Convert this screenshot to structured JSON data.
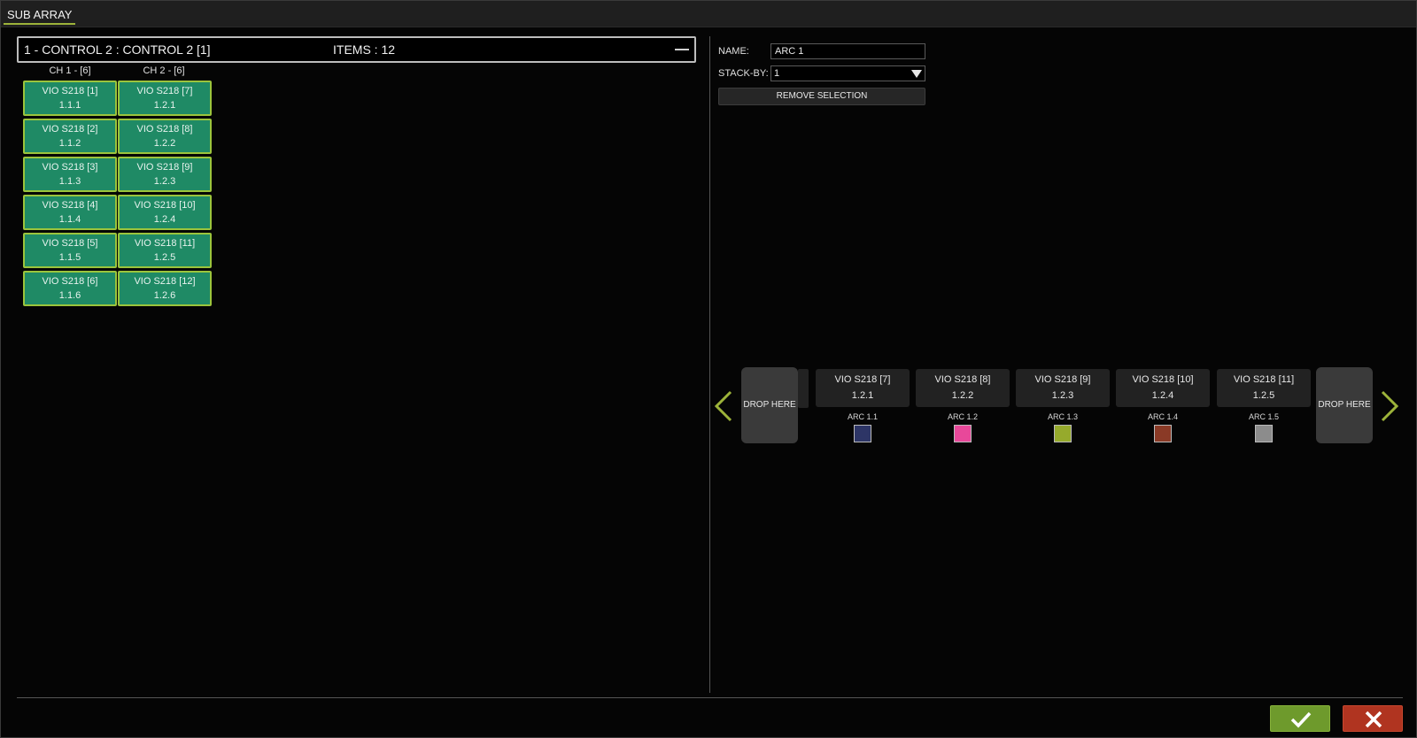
{
  "window": {
    "tab_label": "SUB ARRAY"
  },
  "group": {
    "title": "1 - CONTROL 2 : CONTROL 2  [1]",
    "items": "ITEMS : 12"
  },
  "channels": [
    {
      "label": "CH 1 - [6]",
      "cells": [
        {
          "name": "VIO S218  [1]",
          "addr": "1.1.1"
        },
        {
          "name": "VIO S218  [2]",
          "addr": "1.1.2"
        },
        {
          "name": "VIO S218  [3]",
          "addr": "1.1.3"
        },
        {
          "name": "VIO S218  [4]",
          "addr": "1.1.4"
        },
        {
          "name": "VIO S218  [5]",
          "addr": "1.1.5"
        },
        {
          "name": "VIO S218  [6]",
          "addr": "1.1.6"
        }
      ]
    },
    {
      "label": "CH 2 - [6]",
      "cells": [
        {
          "name": "VIO S218  [7]",
          "addr": "1.2.1"
        },
        {
          "name": "VIO S218  [8]",
          "addr": "1.2.2"
        },
        {
          "name": "VIO S218  [9]",
          "addr": "1.2.3"
        },
        {
          "name": "VIO S218  [10]",
          "addr": "1.2.4"
        },
        {
          "name": "VIO S218  [11]",
          "addr": "1.2.5"
        },
        {
          "name": "VIO S218  [12]",
          "addr": "1.2.6"
        }
      ]
    }
  ],
  "properties": {
    "name_label": "NAME:",
    "name_value": "ARC 1",
    "stack_label": "STACK-BY:",
    "stack_value": "1",
    "remove_label": "REMOVE SELECTION"
  },
  "strip": {
    "drop_label": "DROP HERE",
    "slots": [
      {
        "name": "VIO S218  [7]",
        "addr": "1.2.1",
        "arc": "ARC 1.1",
        "color": "#2d3566"
      },
      {
        "name": "VIO S218  [8]",
        "addr": "1.2.2",
        "arc": "ARC 1.2",
        "color": "#e8489a"
      },
      {
        "name": "VIO S218  [9]",
        "addr": "1.2.3",
        "arc": "ARC 1.3",
        "color": "#96aa2c"
      },
      {
        "name": "VIO S218  [10]",
        "addr": "1.2.4",
        "arc": "ARC 1.4",
        "color": "#8a3a26"
      },
      {
        "name": "VIO S218  [11]",
        "addr": "1.2.5",
        "arc": "ARC 1.5",
        "color": "#8c8c8c"
      }
    ]
  },
  "colors": {
    "accent": "#9bc43c",
    "cell_fill": "#1f8a65",
    "ok": "#6e9a2c",
    "cancel": "#b03420"
  },
  "icons": {
    "prev": "chevron-left-icon",
    "next": "chevron-right-icon",
    "ok": "check-icon",
    "cancel": "close-icon"
  }
}
